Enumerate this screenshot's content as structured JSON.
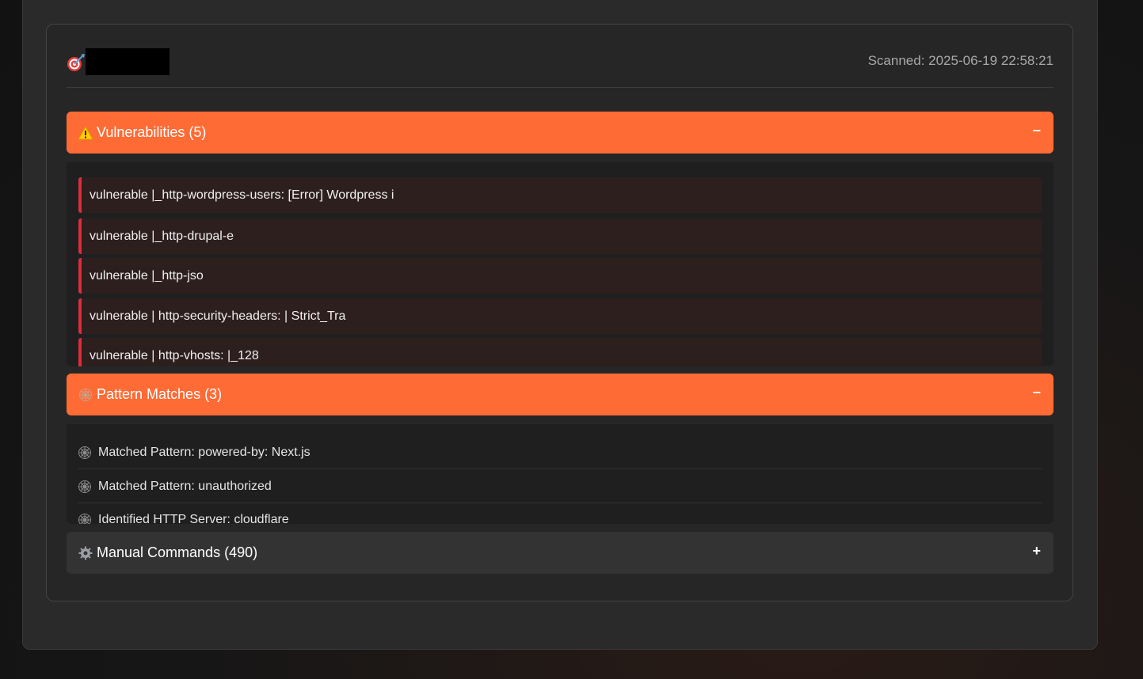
{
  "header": {
    "scan_time": "Scanned: 2025-06-19 22:58:21"
  },
  "vulnerabilities": {
    "title": "Vulnerabilities (5)",
    "toggle": "−",
    "icon": "warning-icon",
    "items": [
      "vulnerable |_http-wordpress-users: [Error] Wordpress i",
      "vulnerable |_http-drupal-e",
      "vulnerable |_http-jso",
      "vulnerable | http-security-headers: | Strict_Tra",
      "vulnerable | http-vhosts: |_128"
    ]
  },
  "patterns": {
    "title": "Pattern Matches (3)",
    "toggle": "−",
    "icon": "spider-web-icon",
    "items": [
      "Matched Pattern: powered-by: Next.js",
      "Matched Pattern: unauthorized",
      "Identified HTTP Server: cloudflare"
    ]
  },
  "manual": {
    "title": "Manual Commands (490)",
    "toggle": "+",
    "icon": "gear-icon"
  },
  "colors": {
    "accent": "#ff6b35",
    "vuln_border": "#dc2d3c"
  }
}
